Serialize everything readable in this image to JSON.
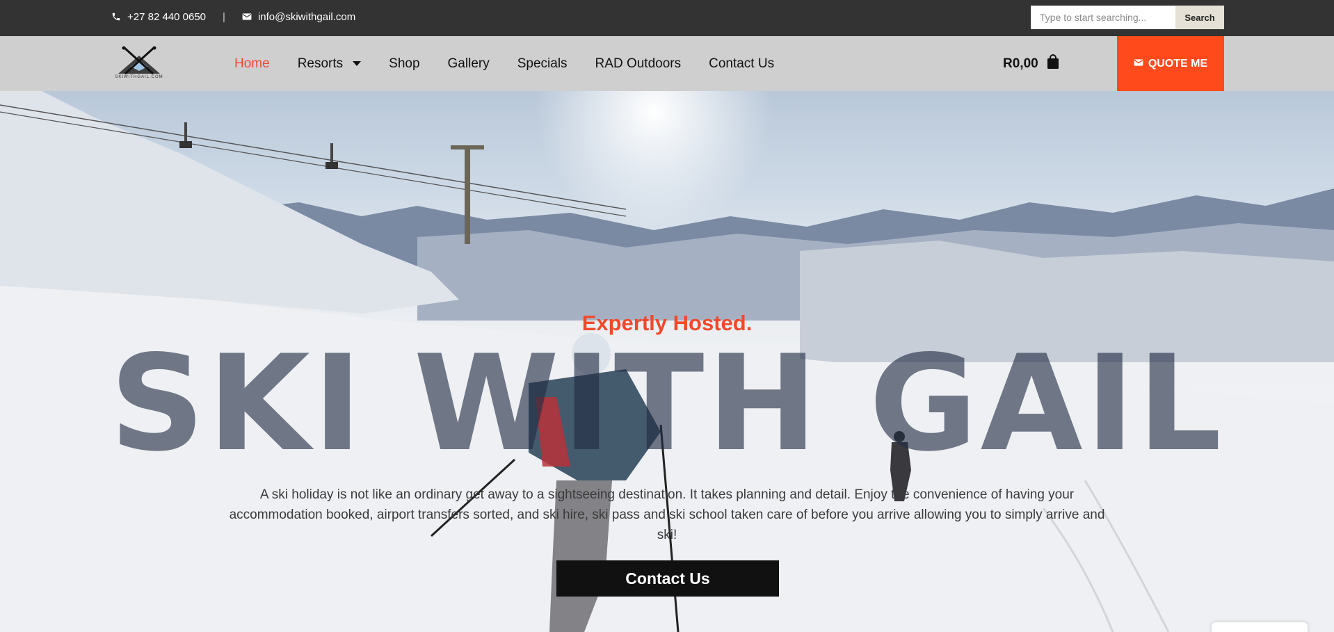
{
  "topbar": {
    "phone": "+27 82 440 0650",
    "separator": "|",
    "email": "info@skiwithgail.com",
    "phone_icon": "phone-icon",
    "email_icon": "envelope-icon",
    "search": {
      "placeholder": "Type to start searching...",
      "button_label": "Search"
    }
  },
  "nav": {
    "logo_text": "SKIWITHGAIL.COM",
    "items": [
      {
        "label": "Home",
        "active": true
      },
      {
        "label": "Resorts",
        "has_dropdown": true
      },
      {
        "label": "Shop"
      },
      {
        "label": "Gallery"
      },
      {
        "label": "Specials"
      },
      {
        "label": "RAD Outdoors"
      },
      {
        "label": "Contact Us"
      }
    ],
    "cart_total": "R0,00",
    "cart_icon": "shopping-bag-icon",
    "quote_label": "QUOTE ME",
    "quote_icon": "envelope-icon"
  },
  "hero": {
    "eyebrow": "Expertly Hosted.",
    "headline": "SKI WITH GAIL",
    "description": "A ski holiday is not like an ordinary get away to a sightseeing destination. It takes planning and detail. Enjoy the convenience of having your accommodation booked, airport transfers sorted, and ski hire, ski pass and ski school taken care of before you arrive allowing you to simply arrive and ski!",
    "cta_label": "Contact Us"
  },
  "colors": {
    "topbar_bg": "#333333",
    "nav_bg": "#cfcfcf",
    "accent": "#f0492c",
    "quote_bg": "#ff4a1c",
    "cta_bg": "#111111"
  }
}
